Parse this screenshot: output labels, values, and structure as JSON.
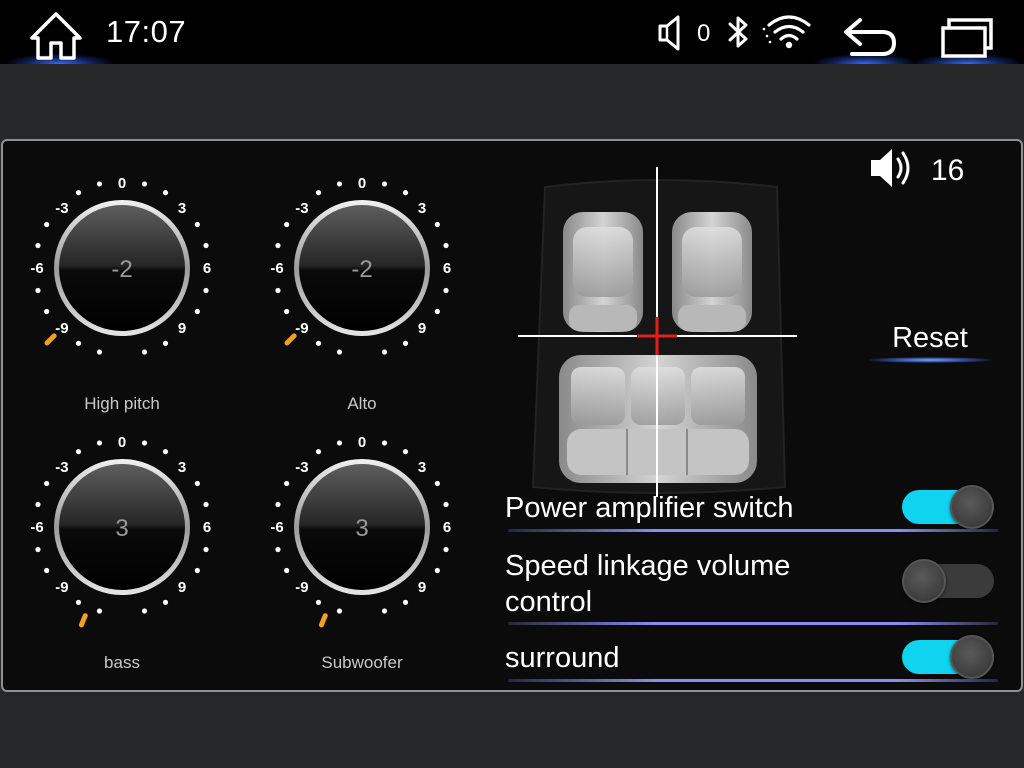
{
  "status_bar": {
    "time": "17:07",
    "volume_value": "0",
    "icons": [
      "home-icon",
      "volume-icon",
      "bluetooth-icon",
      "wifi-icon",
      "back-icon",
      "recent-apps-icon"
    ]
  },
  "knobs": [
    {
      "label": "High pitch",
      "value": "-2",
      "numeric_value": -2,
      "scale": [
        "-9",
        "-6",
        "-3",
        "0",
        "3",
        "6",
        "9"
      ]
    },
    {
      "label": "Alto",
      "value": "-2",
      "numeric_value": -2,
      "scale": [
        "-9",
        "-6",
        "-3",
        "0",
        "3",
        "6",
        "9"
      ]
    },
    {
      "label": "bass",
      "value": "3",
      "numeric_value": 3,
      "scale": [
        "-9",
        "-6",
        "-3",
        "0",
        "3",
        "6",
        "9"
      ]
    },
    {
      "label": "Subwoofer",
      "value": "3",
      "numeric_value": 3,
      "scale": [
        "-9",
        "-6",
        "-3",
        "0",
        "3",
        "6",
        "9"
      ]
    }
  ],
  "volume": {
    "value": "16",
    "icon": "speaker-icon"
  },
  "reset_label": "Reset",
  "settings": [
    {
      "label": "Power amplifier switch",
      "on": true
    },
    {
      "label": "Speed linkage volume control",
      "on": false
    },
    {
      "label": "surround",
      "on": true
    }
  ],
  "colors": {
    "accent_toggle": "#10d4ef",
    "indicator": "#f0a020",
    "focus_cross": "#e02020",
    "divider": "#8b8cf0",
    "glow": "#3c6eff"
  }
}
